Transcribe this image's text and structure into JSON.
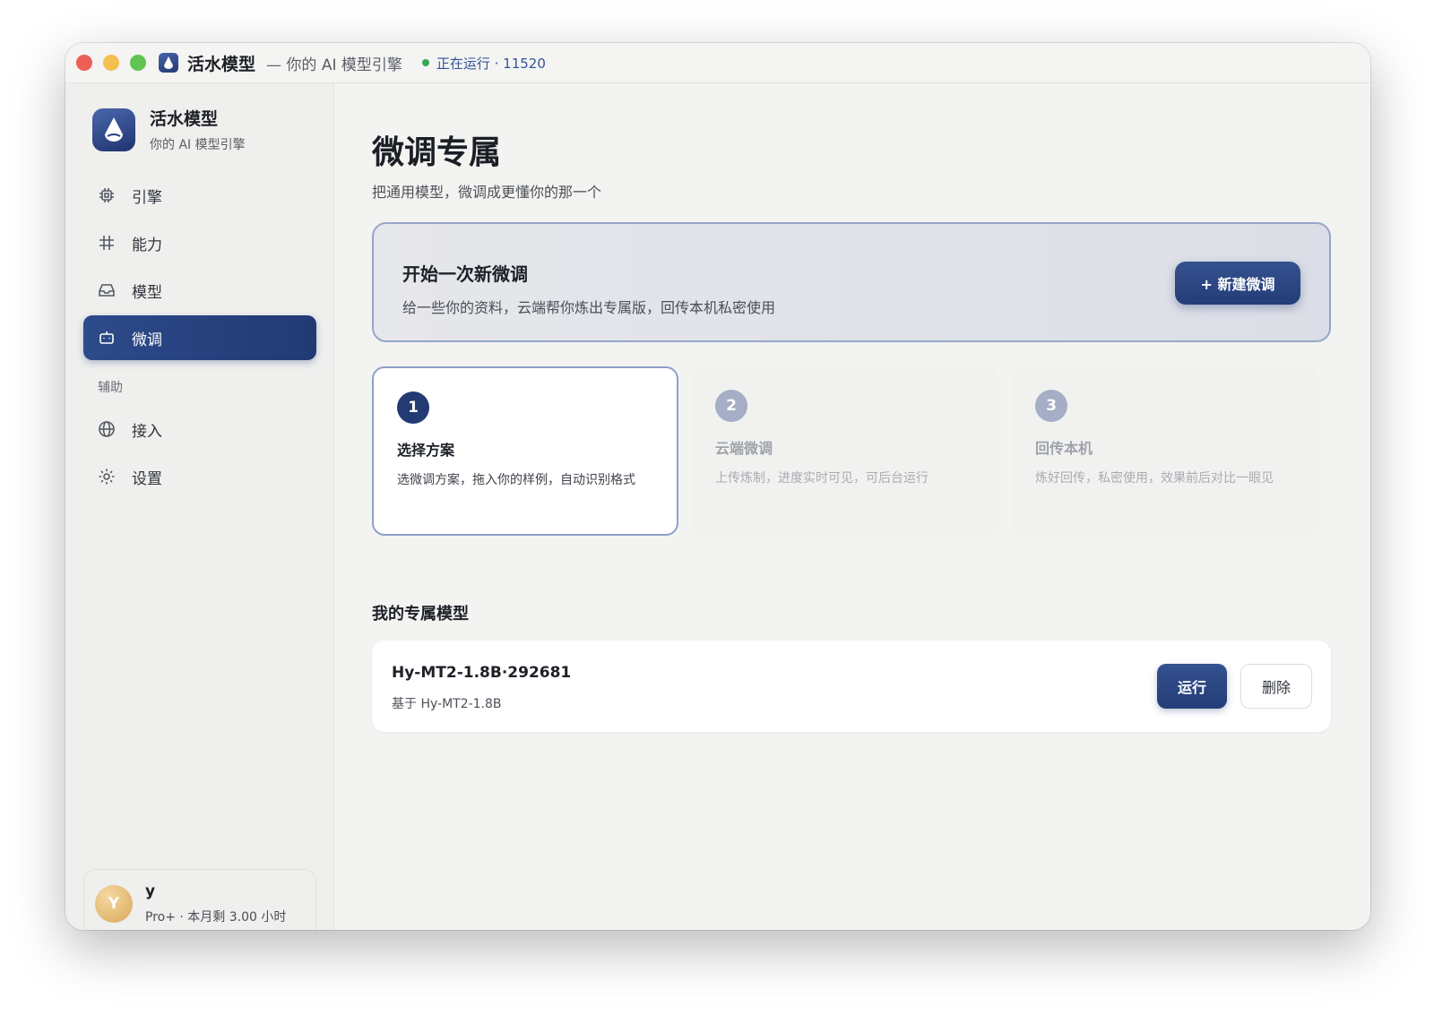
{
  "window": {
    "title": "活水模型",
    "subtitle": "— 你的 AI 模型引擎",
    "status": "正在运行 · 11520",
    "status_color": "#35a853"
  },
  "brand": {
    "name": "活水模型",
    "tagline": "你的 AI 模型引擎",
    "logo_icon": "water-drop-icon"
  },
  "sidebar": {
    "items": [
      {
        "label": "引擎",
        "icon": "chip-icon",
        "active": false
      },
      {
        "label": "能力",
        "icon": "hash-icon",
        "active": false
      },
      {
        "label": "模型",
        "icon": "inbox-icon",
        "active": false
      },
      {
        "label": "微调",
        "icon": "robot-icon",
        "active": true
      }
    ],
    "section_label": "辅助",
    "aux_items": [
      {
        "label": "接入",
        "icon": "globe-icon"
      },
      {
        "label": "设置",
        "icon": "gear-icon"
      }
    ]
  },
  "user": {
    "avatar_letter": "Y",
    "name": "y",
    "plan": "Pro+ · 本月剩 3.00 小时"
  },
  "main": {
    "title": "微调专属",
    "subtitle": "把通用模型，微调成更懂你的那一个",
    "hero": {
      "title": "开始一次新微调",
      "description": "给一些你的资料，云端帮你炼出专属版，回传本机私密使用",
      "button_label": "+ 新建微调"
    },
    "steps": [
      {
        "number": "1",
        "title": "选择方案",
        "description": "选微调方案，拖入你的样例，自动识别格式",
        "active": true
      },
      {
        "number": "2",
        "title": "云端微调",
        "description": "上传炼制，进度实时可见，可后台运行",
        "active": false
      },
      {
        "number": "3",
        "title": "回传本机",
        "description": "炼好回传，私密使用，效果前后对比一眼见",
        "active": false
      }
    ],
    "models_section_title": "我的专属模型",
    "models": [
      {
        "name": "Hy-MT2-1.8B·292681",
        "base": "基于 Hy-MT2-1.8B",
        "run_label": "运行",
        "delete_label": "删除"
      }
    ]
  },
  "colors": {
    "accent": "#243d78",
    "window_bg": "#f3f3f1"
  }
}
